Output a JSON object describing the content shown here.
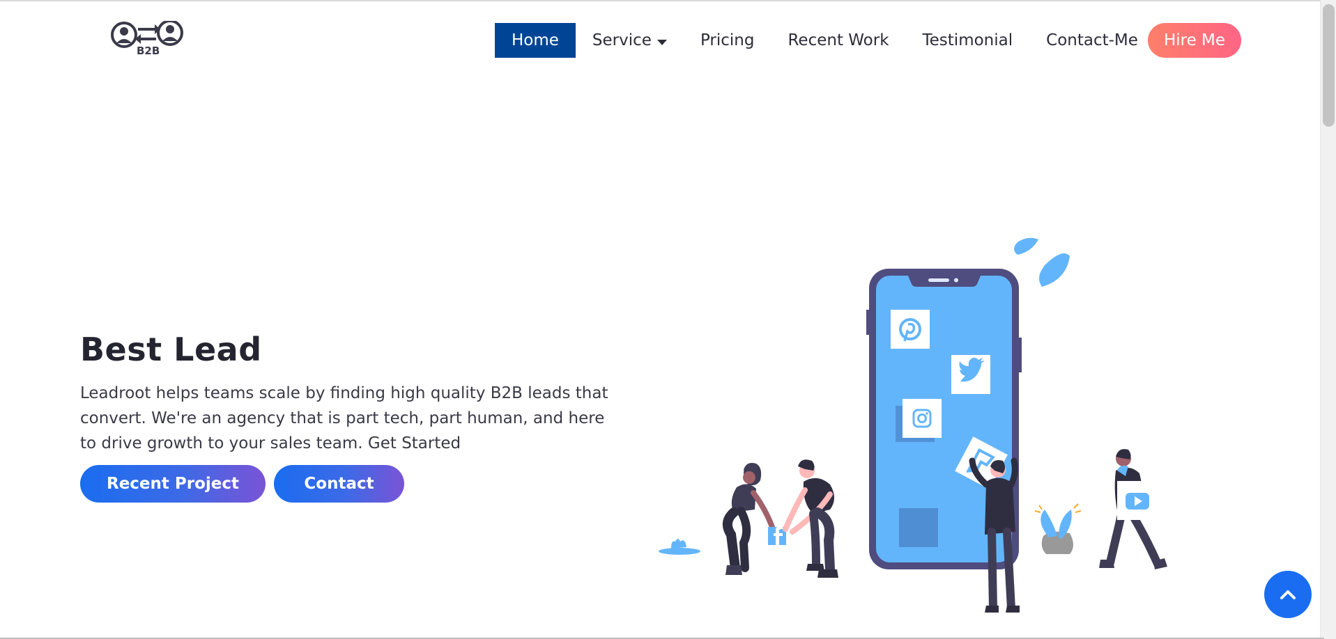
{
  "header": {
    "logo_text": "B2B",
    "nav": [
      {
        "label": "Home",
        "active": true
      },
      {
        "label": "Service",
        "has_dropdown": true
      },
      {
        "label": "Pricing"
      },
      {
        "label": "Recent Work"
      },
      {
        "label": "Testimonial"
      },
      {
        "label": "Contact-Me"
      }
    ],
    "hire_label": "Hire Me"
  },
  "hero": {
    "title": "Best Lead",
    "text": "Leadroot helps teams scale by finding high quality B2B leads that convert. We're an agency that is part tech, part human, and here to drive growth to your sales team. Get Started",
    "buttons": {
      "recent_project": "Recent Project",
      "contact": "Contact"
    }
  },
  "icons": {
    "social": [
      "pinterest-icon",
      "twitter-icon",
      "instagram-icon",
      "foursquare-icon",
      "facebook-icon",
      "youtube-icon"
    ],
    "back_to_top": "chevron-up-icon"
  },
  "colors": {
    "nav_active": "#004595",
    "hire_gradient": [
      "#fe7f6a",
      "#ff6584"
    ],
    "button_gradient": [
      "#1a6df0",
      "#7a54d6"
    ],
    "phone_screen": "#63b5fb",
    "phone_frame": "#4f4c7f"
  }
}
